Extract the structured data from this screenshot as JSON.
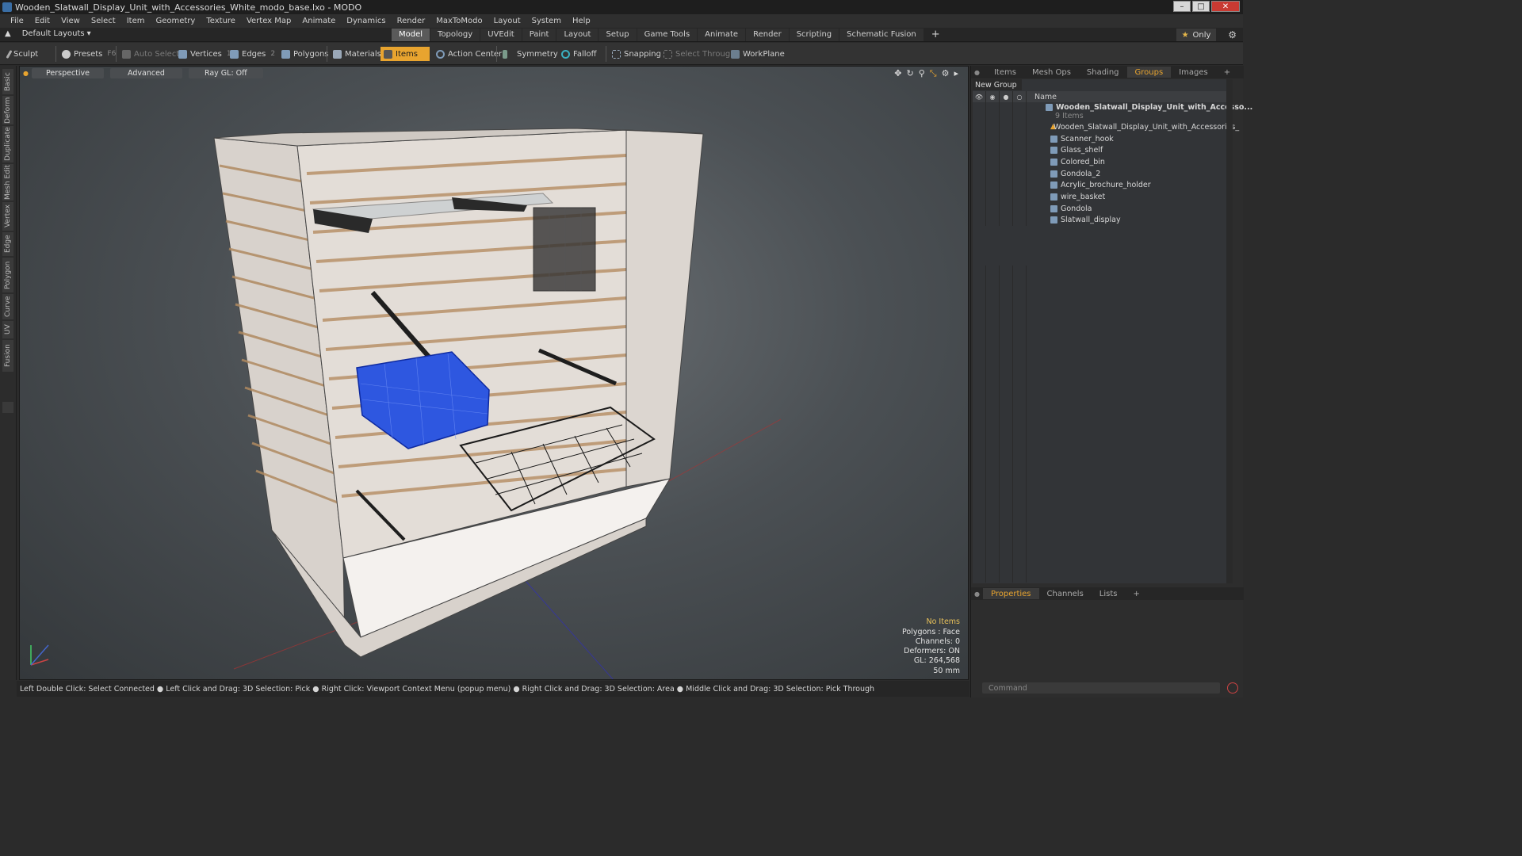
{
  "window": {
    "title": "Wooden_Slatwall_Display_Unit_with_Accessories_White_modo_base.lxo - MODO",
    "min": "–",
    "max": "□",
    "close": "✕"
  },
  "menu": [
    "File",
    "Edit",
    "View",
    "Select",
    "Item",
    "Geometry",
    "Texture",
    "Vertex Map",
    "Animate",
    "Dynamics",
    "Render",
    "MaxToModo",
    "Layout",
    "System",
    "Help"
  ],
  "layout": {
    "default_layouts": "Default Layouts",
    "tabs": [
      "Model",
      "Topology",
      "UVEdit",
      "Paint",
      "Layout",
      "Setup",
      "Game Tools",
      "Animate",
      "Render",
      "Scripting",
      "Schematic Fusion"
    ],
    "active_tab": "Model",
    "plus": "+",
    "only_label": "Only"
  },
  "toolbar": {
    "sculpt": "Sculpt",
    "presets": "Presets",
    "presets_key": "F6",
    "auto_select": "Auto Select",
    "vertices": "Vertices",
    "vertices_key": "1",
    "edges": "Edges",
    "edges_key": "2",
    "polygons": "Polygons",
    "materials": "Materials",
    "items": "Items",
    "action_center": "Action Center",
    "symmetry": "Symmetry",
    "falloff": "Falloff",
    "snapping": "Snapping",
    "select_through": "Select Through",
    "workplane": "WorkPlane"
  },
  "left_tabs": [
    "Basic",
    "Deform",
    "Duplicate",
    "Mesh Edit",
    "Vertex",
    "Edge",
    "Polygon",
    "Curve",
    "UV",
    "Fusion"
  ],
  "viewport": {
    "view_mode": "Perspective",
    "advanced": "Advanced",
    "ray_gl": "Ray GL: Off",
    "stats": {
      "no_items": "No Items",
      "polygons": "Polygons : Face",
      "channels": "Channels: 0",
      "deformers": "Deformers: ON",
      "gl": "GL: 264,568",
      "scale": "50 mm"
    }
  },
  "statusbar": "Left Double Click: Select Connected ● Left Click and Drag: 3D Selection: Pick ● Right Click: Viewport Context Menu (popup menu) ● Right Click and Drag: 3D Selection: Area ● Middle Click and Drag: 3D Selection: Pick Through",
  "right_panel": {
    "top_tabs": [
      "Items",
      "Mesh Ops",
      "Shading",
      "Groups",
      "Images"
    ],
    "active_top_tab": "Groups",
    "new_group": "New Group",
    "name_header": "Name",
    "group_name": "Wooden_Slatwall_Display_Unit_with_Accesso...",
    "group_count": "9 Items",
    "items": [
      "Wooden_Slatwall_Display_Unit_with_Accessories_",
      "Scanner_hook",
      "Glass_shelf",
      "Colored_bin",
      "Gondola_2",
      "Acrylic_brochure_holder",
      "wire_basket",
      "Gondola",
      "Slatwall_display"
    ],
    "bottom_tabs": [
      "Properties",
      "Channels",
      "Lists"
    ],
    "active_bottom_tab": "Properties",
    "command_placeholder": "Command"
  },
  "colors": {
    "accent": "#e8a42f",
    "bin_blue": "#2e57e0",
    "close_red": "#c93a32"
  }
}
